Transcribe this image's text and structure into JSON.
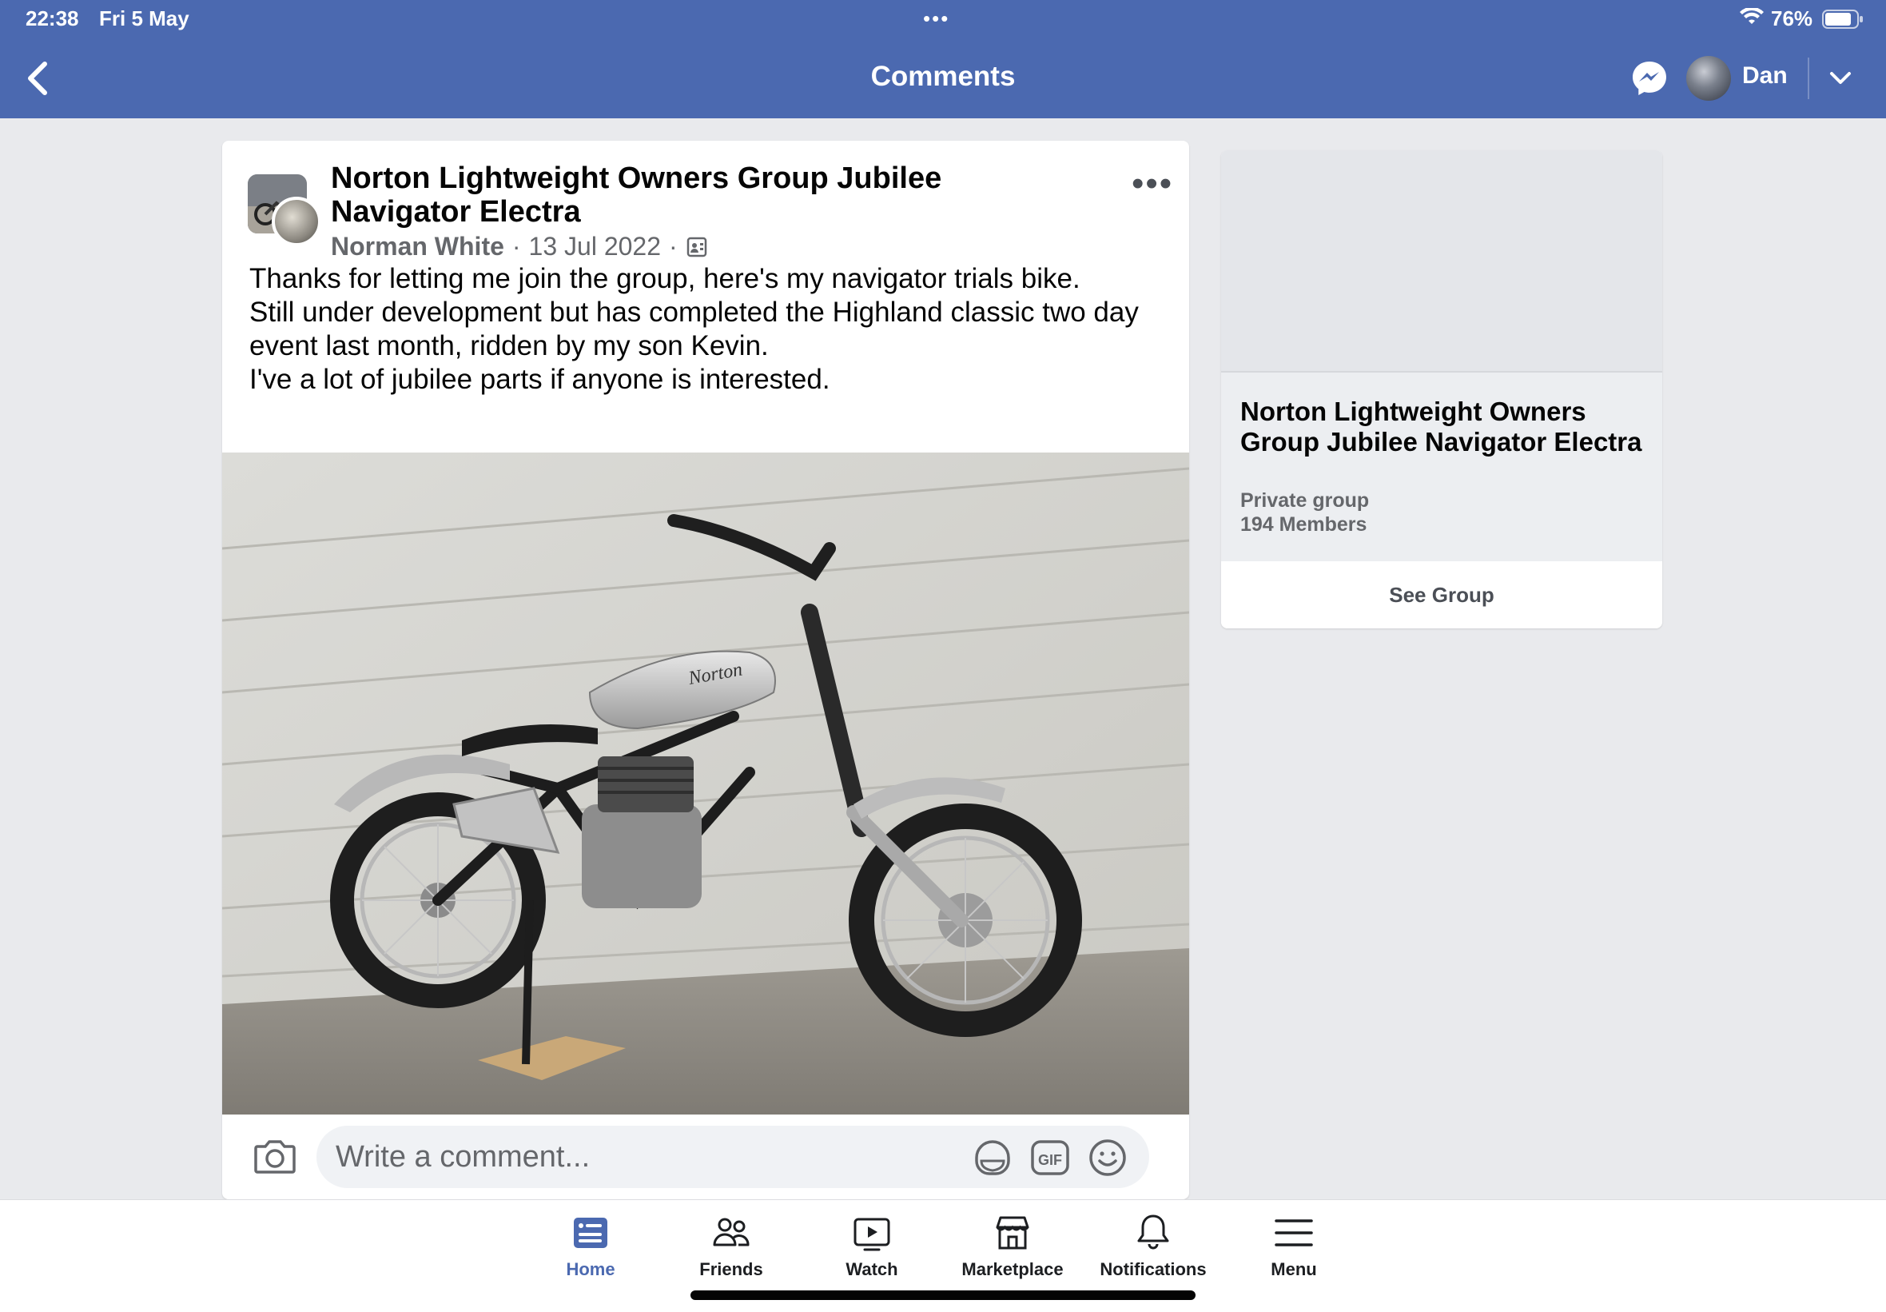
{
  "status_bar": {
    "time": "22:38",
    "date": "Fri 5 May",
    "battery": "76%"
  },
  "header": {
    "title": "Comments",
    "user_name": "Dan"
  },
  "post": {
    "group_name": "Norton Lightweight Owners Group Jubilee Navigator Electra",
    "author": "Norman White",
    "separator": "·",
    "date": "13 Jul 2022",
    "text_lines": [
      "Thanks for letting me join the group,  here's my navigator trials bike.",
      "Still under development but has completed the Highland classic two day event last month, ridden by my son Kevin.",
      "I've a lot of jubilee parts if anyone is interested."
    ],
    "photo_sign_text": "Norton"
  },
  "comment_box": {
    "placeholder": "Write a comment..."
  },
  "group_card": {
    "name": "Norton Lightweight Owners Group Jubilee Navigator Electra",
    "privacy": "Private group",
    "members": "194 Members",
    "button": "See Group"
  },
  "tabbar": {
    "tabs": [
      {
        "label": "Home",
        "icon": "home-feed-icon",
        "active": true
      },
      {
        "label": "Friends",
        "icon": "friends-icon",
        "active": false
      },
      {
        "label": "Watch",
        "icon": "watch-icon",
        "active": false
      },
      {
        "label": "Marketplace",
        "icon": "marketplace-icon",
        "active": false
      },
      {
        "label": "Notifications",
        "icon": "bell-icon",
        "active": false
      },
      {
        "label": "Menu",
        "icon": "hamburger-icon",
        "active": false
      }
    ]
  },
  "colors": {
    "header_bg": "#4b69b0",
    "active_tab": "#4b69b0",
    "page_bg": "#e9eaed"
  }
}
